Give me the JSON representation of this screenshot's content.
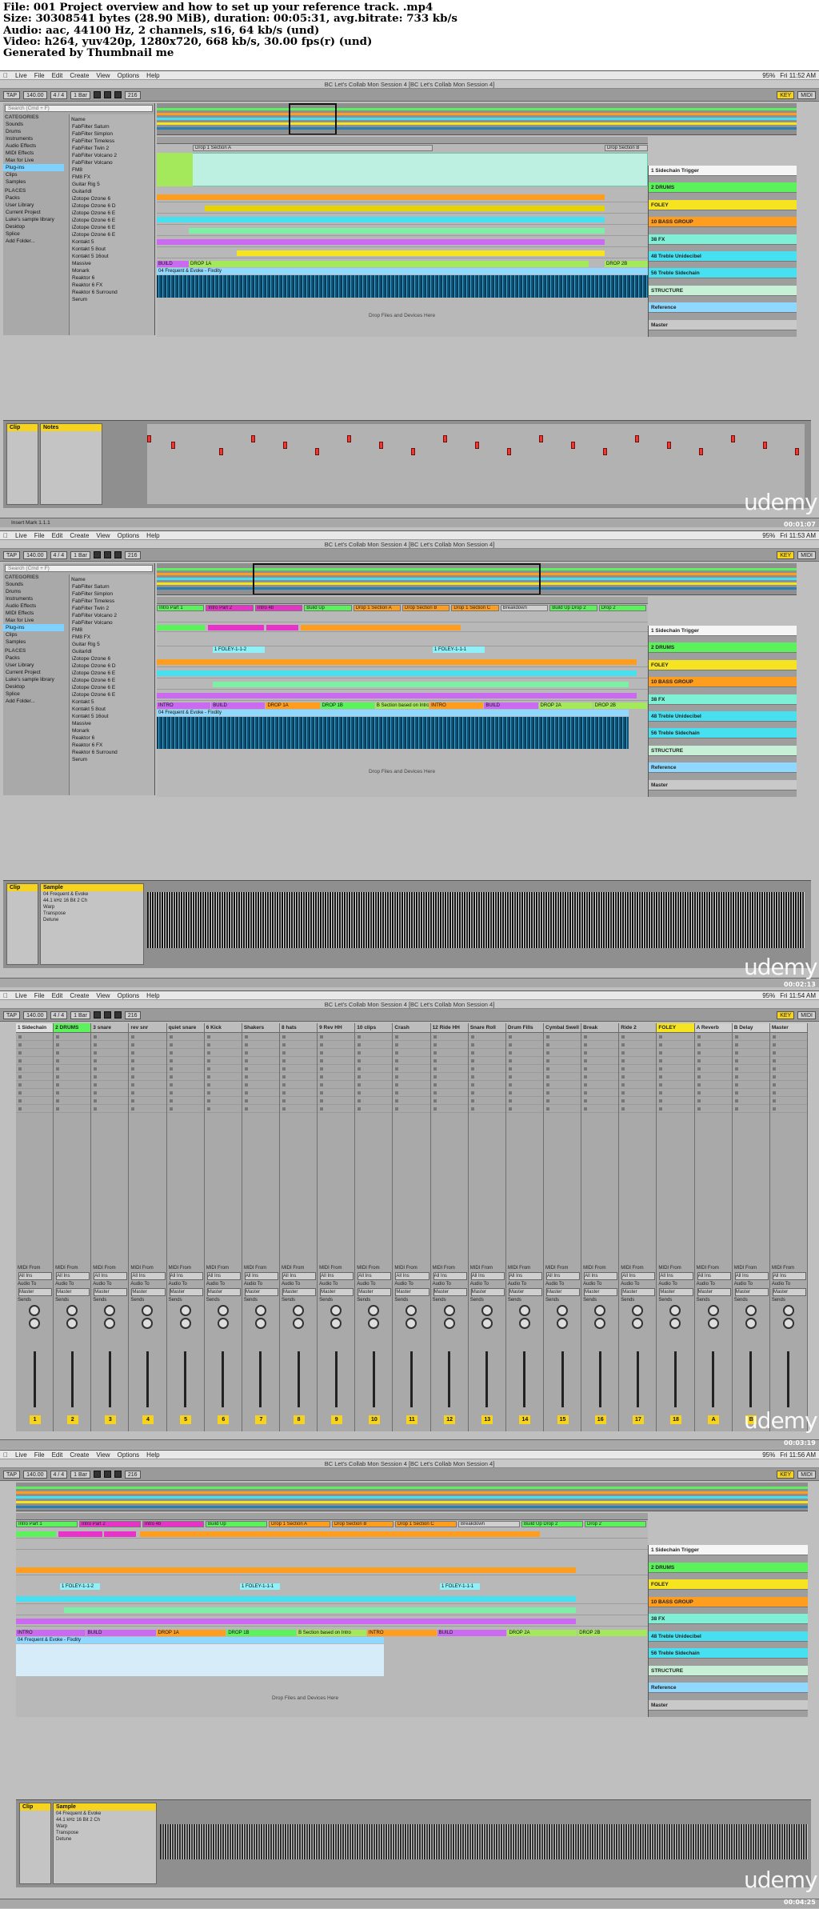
{
  "header": {
    "line1": "File: 001 Project overview and how to set up your reference track. .mp4",
    "line2": "Size: 30308541 bytes (28.90 MiB), duration: 00:05:31, avg.bitrate: 733 kb/s",
    "line3": "Audio: aac, 44100 Hz, 2 channels, s16, 64 kb/s (und)",
    "line4": "Video: h264, yuv420p, 1280x720, 668 kb/s, 30.00 fps(r) (und)",
    "line5": "Generated by Thumbnail me"
  },
  "menubar": {
    "app": "Live",
    "items": [
      "File",
      "Edit",
      "Create",
      "View",
      "Options",
      "Help"
    ],
    "status": "95%",
    "times": [
      "Fri 11:52 AM",
      "Fri 11:53 AM",
      "Fri 11:54 AM",
      "Fri 11:56 AM"
    ]
  },
  "window_title": "BC Let's Collab Mon Session 4 [BC Let's Collab Mon Session 4]",
  "transport": {
    "tap": "TAP",
    "tempo": "140.00",
    "meter": "4 / 4",
    "bar": "1 Bar",
    "pos": "216",
    "key": "KEY",
    "midi": "MIDI"
  },
  "browser": {
    "search": "Search (Cmd + F)",
    "categories_header": "CATEGORIES",
    "categories": [
      "Sounds",
      "Drums",
      "Instruments",
      "Audio Effects",
      "MIDI Effects",
      "Max for Live",
      "Plug-ins",
      "Clips",
      "Samples"
    ],
    "places_header": "PLACES",
    "places": [
      "Packs",
      "User Library",
      "Current Project",
      "Luke's sample library",
      "Desktop",
      "Splice",
      "Add Folder..."
    ],
    "name_header": "Name",
    "names": [
      "FabFilter Saturn",
      "FabFilter Simplon",
      "FabFilter Timeless",
      "FabFilter Twin 2",
      "FabFilter Volcano 2",
      "FabFilter Volcano",
      "FM8",
      "FM8 FX",
      "Guitar Rig 5",
      "GuitarIdl",
      "iZotope Ozone 6",
      "iZotope Ozone 6 D",
      "iZotope Ozone 6 E",
      "iZotope Ozone 6 E",
      "iZotope Ozone 6 E",
      "iZotope Ozone 6 E",
      "Kontakt 5",
      "Kontakt 5 8out",
      "Kontakt 5 16out",
      "Massive",
      "Monark",
      "Reaktor 6",
      "Reaktor 6 FX",
      "Reaktor 6 Surround",
      "Serum"
    ]
  },
  "scenes1": [
    "Drop 1 Section A",
    "Drop Section B"
  ],
  "scenes2": [
    "Intro Part 1",
    "Intro Part 2",
    "Intro 4b",
    "Build Up",
    "Drop 1 Section A",
    "Drop Section B",
    "Drop 1 Section C",
    "Breakdown",
    "Build Up Drop 2",
    "Drop 2"
  ],
  "sections": [
    "INTRO",
    "BUILD",
    "DROP 1A",
    "DROP 1B",
    "B Section based on Intro",
    "INTRO",
    "BUILD",
    "DROP 2A",
    "DROP 2B"
  ],
  "tracks": [
    {
      "name": "1 Sidechain Trigger",
      "color": "#f5f5f5"
    },
    {
      "name": "2 DRUMS",
      "color": "#5cf25c"
    },
    {
      "name": "FOLEY",
      "color": "#f5e41f"
    },
    {
      "name": "10 BASS GROUP",
      "color": "#ff9d1f"
    },
    {
      "name": "38 FX",
      "color": "#7ef0d6"
    },
    {
      "name": "48 Treble Unidecibel",
      "color": "#46e0f0"
    },
    {
      "name": "56 Treble Sidechain",
      "color": "#46e0f0"
    },
    {
      "name": "STRUCTURE",
      "color": "#c8f0d6"
    },
    {
      "name": "Reference",
      "color": "#8fd8ff"
    },
    {
      "name": "Master",
      "color": "#c9c9c9"
    }
  ],
  "reference_clip": "04 Frequent & Evoke - Fixdity",
  "drop_hint": "Drop Files and Devices Here",
  "clip_view": {
    "title1": "Clip",
    "notes_title": "Notes",
    "sample_title": "Sample",
    "sample_name": "04 Frequent & Evoke",
    "sample_info": "44.1 kHz 16 Bit 2 Ch",
    "warp": "Warp",
    "transpose": "Transpose",
    "detune": "Detune"
  },
  "statusbar": "Insert Mark 1.1.1",
  "mixer": {
    "tracks": [
      "1 Sidechain",
      "2 DRUMS",
      "3 snare",
      "rev snr",
      "quiet snare",
      "6 Kick",
      "Shakers",
      "8 hats",
      "9 Rev HH",
      "10 clips",
      "Crash",
      "12 Ride HH",
      "Snare Roll",
      "Drum Fills",
      "Cymbal Swell",
      "Break",
      "Ride 2",
      "FOLEY",
      "A Reverb",
      "B Delay",
      "Master"
    ],
    "numbers": [
      "1",
      "2",
      "3",
      "4",
      "5",
      "6",
      "7",
      "8",
      "9",
      "10",
      "11",
      "12",
      "13",
      "14",
      "15",
      "16",
      "17",
      "18",
      "A",
      "B"
    ],
    "labels": {
      "midi_from": "MIDI From",
      "audio_to": "Audio To",
      "all_ins": "All Ins",
      "sends": "Sends",
      "master": "Master",
      "group": "Group"
    }
  },
  "watermark": "udemy",
  "timecodes": [
    "00:01:07",
    "00:02:13",
    "00:03:19",
    "00:04:25"
  ]
}
